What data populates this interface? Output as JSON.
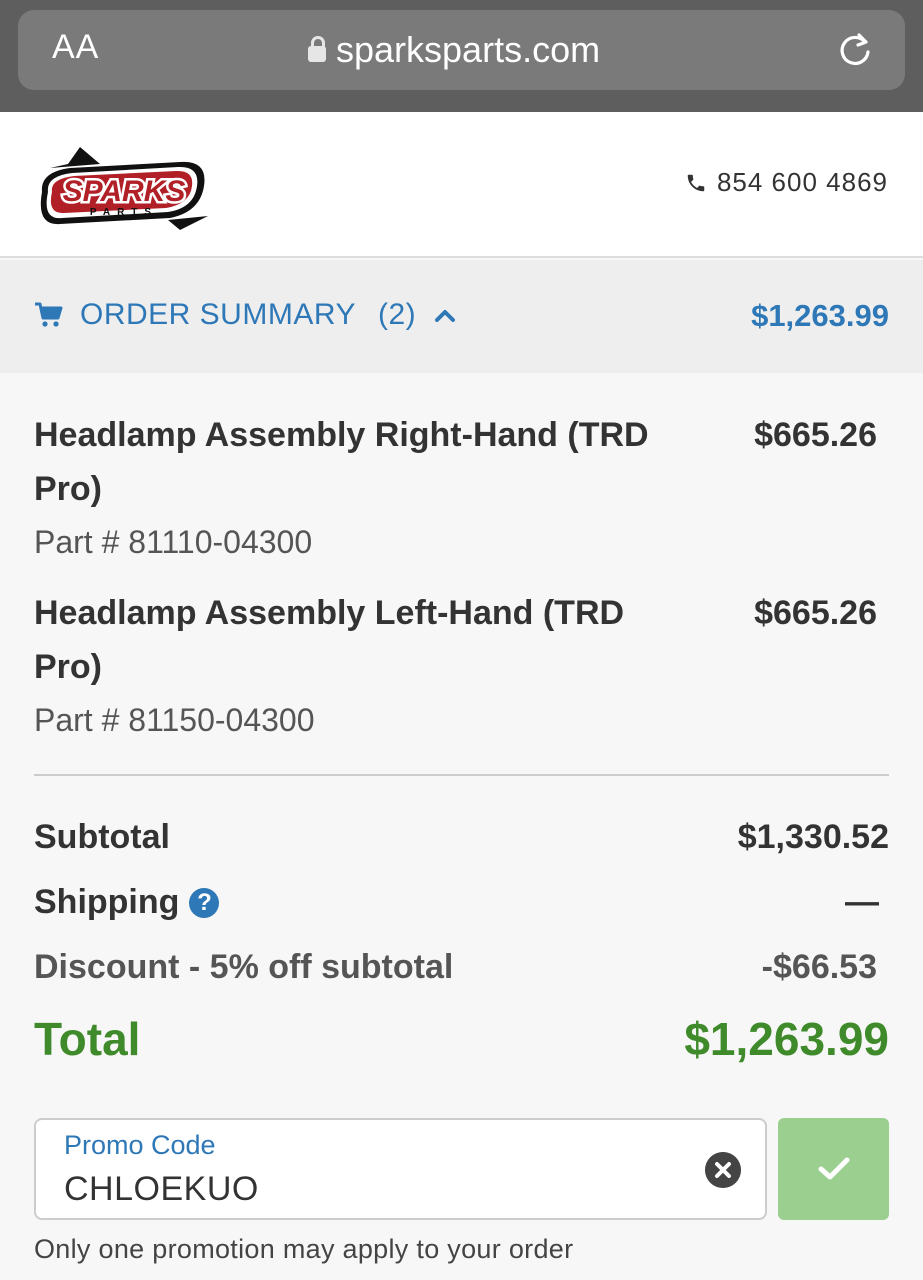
{
  "browser": {
    "text_size_label": "AA",
    "url": "sparksparts.com"
  },
  "header": {
    "logo_text": "SPARKS",
    "logo_subtext": "PARTS",
    "phone": "854 600 4869"
  },
  "order_summary": {
    "label": "ORDER SUMMARY",
    "count": "(2)",
    "total": "$1,263.99"
  },
  "items": [
    {
      "name": "Headlamp Assembly Right-Hand (TRD Pro)",
      "price": "$665.26",
      "part": "Part # 81110-04300"
    },
    {
      "name": "Headlamp Assembly Left-Hand (TRD Pro)",
      "price": "$665.26",
      "part": "Part # 81150-04300"
    }
  ],
  "totals": {
    "subtotal_label": "Subtotal",
    "subtotal_value": "$1,330.52",
    "shipping_label": "Shipping",
    "shipping_value": "—",
    "discount_label": "Discount - 5% off subtotal",
    "discount_value": "-$66.53",
    "total_label": "Total",
    "total_value": "$1,263.99"
  },
  "promo": {
    "label": "Promo Code",
    "value": "CHLOEKUO",
    "note": "Only one promotion may apply to your order"
  },
  "colors": {
    "accent": "#2e78b7",
    "total_green": "#3f8a2a",
    "apply_button": "#9bcf8f"
  }
}
